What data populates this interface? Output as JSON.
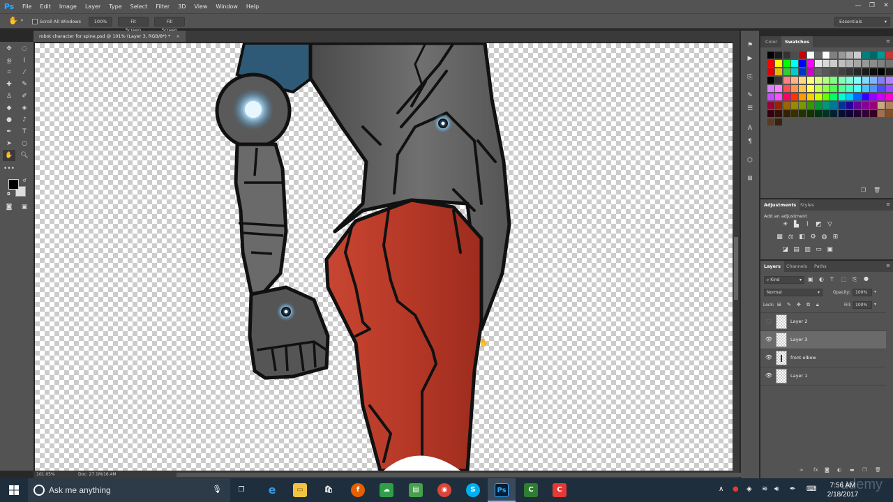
{
  "app": {
    "logo": "Ps",
    "menu": [
      "File",
      "Edit",
      "Image",
      "Layer",
      "Type",
      "Select",
      "Filter",
      "3D",
      "View",
      "Window",
      "Help"
    ],
    "window_controls": [
      "—",
      "❐",
      "✕"
    ]
  },
  "options_bar": {
    "scroll_all_windows": "Scroll All Windows",
    "zoom_value": "100%",
    "fit_screen": "Fit Screen",
    "fill_screen": "Fill Screen",
    "workspace": "Essentials"
  },
  "document": {
    "tab_title": "robot character for spine.psd @ 101% (Layer 3, RGB/8*) *",
    "close": "×",
    "zoom": "101.05%",
    "doc_info": "Doc: 27.1M/16.4M"
  },
  "color_panel": {
    "tabs": [
      "Color",
      "Swatches"
    ],
    "active_tab": "Swatches",
    "swatches": [
      [
        "#000000",
        "#1a1a1a",
        "#333333",
        "#4d4d4d",
        "#cc0000",
        "#ffffff",
        "#666666",
        "#ffffff",
        "#808080",
        "#999999",
        "#b3b3b3",
        "#cccccc",
        "#008080",
        "#006666",
        "#009999",
        "#cc3333"
      ],
      [
        "#ff0000",
        "#ffff00",
        "#00ff00",
        "#00ffff",
        "#0000ff",
        "#ff00ff",
        "#e6e6e6",
        "#d9d9d9",
        "#cccccc",
        "#bfbfbf",
        "#b3b3b3",
        "#a6a6a6",
        "#999999",
        "#8c8c8c",
        "#808080",
        "#737373"
      ],
      [
        "#e60000",
        "#e6b800",
        "#33cc33",
        "#00cccc",
        "#0033cc",
        "#cc00cc",
        "#666666",
        "#595959",
        "#4d4d4d",
        "#404040",
        "#333333",
        "#262626",
        "#1a1a1a",
        "#0d0d0d",
        "#000000",
        "#1a1a1a"
      ],
      [
        "#000000",
        "#333333",
        "#ff8080",
        "#ffb380",
        "#ffd980",
        "#ffff80",
        "#d9ff80",
        "#b3ff80",
        "#80ff80",
        "#80ffb3",
        "#80ffd9",
        "#80ffff",
        "#80d9ff",
        "#80b3ff",
        "#8080ff",
        "#b380ff"
      ],
      [
        "#d980ff",
        "#ff80ff",
        "#ff4d4d",
        "#ff944d",
        "#ffc44d",
        "#ffff4d",
        "#c4ff4d",
        "#94ff4d",
        "#4dff4d",
        "#4dff94",
        "#4dffc4",
        "#4dffff",
        "#4dc4ff",
        "#4d94ff",
        "#4d4dff",
        "#944dff"
      ],
      [
        "#c44dff",
        "#ff4dff",
        "#ff0066",
        "#ff3300",
        "#ff9900",
        "#ffcc00",
        "#ccff00",
        "#66ff00",
        "#00ff66",
        "#00ffcc",
        "#00ccff",
        "#0066ff",
        "#3300ff",
        "#9900ff",
        "#cc00ff",
        "#ff00cc"
      ],
      [
        "#990033",
        "#992200",
        "#996600",
        "#998800",
        "#779900",
        "#339900",
        "#009933",
        "#009977",
        "#007799",
        "#003399",
        "#220099",
        "#660099",
        "#880099",
        "#990077",
        "#c8a882",
        "#b08060"
      ],
      [
        "#330011",
        "#331100",
        "#332200",
        "#333300",
        "#223300",
        "#113300",
        "#003311",
        "#003322",
        "#002233",
        "#001133",
        "#110033",
        "#220033",
        "#330033",
        "#330022",
        "#a07050",
        "#805030"
      ],
      [
        "#5a3a20",
        "#3a2010"
      ]
    ]
  },
  "adjustments_panel": {
    "tabs": [
      "Adjustments",
      "Styles"
    ],
    "active_tab": "Adjustments",
    "hint": "Add an adjustment",
    "icons": [
      [
        "brightness-icon",
        "levels-icon",
        "curves-icon",
        "exposure-icon",
        "triangle-icon"
      ],
      [
        "vibrance-icon",
        "hue-sat-icon",
        "color-balance-icon",
        "bw-icon",
        "photo-filter-icon",
        "channel-mixer-icon",
        "color-lookup-icon"
      ],
      [
        "invert-icon",
        "posterize-icon",
        "threshold-icon",
        "gradient-map-icon",
        "selective-color-icon"
      ]
    ]
  },
  "layers_panel": {
    "tabs": [
      "Layers",
      "Channels",
      "Paths"
    ],
    "active_tab": "Layers",
    "kind": "Kind",
    "blend_mode": "Normal",
    "opacity_label": "Opacity:",
    "opacity": "100%",
    "lock_label": "Lock:",
    "fill_label": "Fill:",
    "fill": "100%",
    "layers": [
      {
        "name": "Layer 2",
        "visible": false,
        "selected": false
      },
      {
        "name": "Layer 3",
        "visible": true,
        "selected": true
      },
      {
        "name": "front elbow",
        "visible": true,
        "selected": false
      },
      {
        "name": "Layer 1",
        "visible": true,
        "selected": false
      }
    ]
  },
  "taskbar": {
    "search_placeholder": "Ask me anything",
    "time": "7:56 AM",
    "date": "2/18/2017",
    "watermark": "udemy"
  },
  "colors": {
    "robot_gray": "#5b5b5b",
    "robot_red": "#b23a2a",
    "robot_blue": "#2e5a78",
    "glow": "#8fd3ff",
    "outline": "#111111"
  }
}
